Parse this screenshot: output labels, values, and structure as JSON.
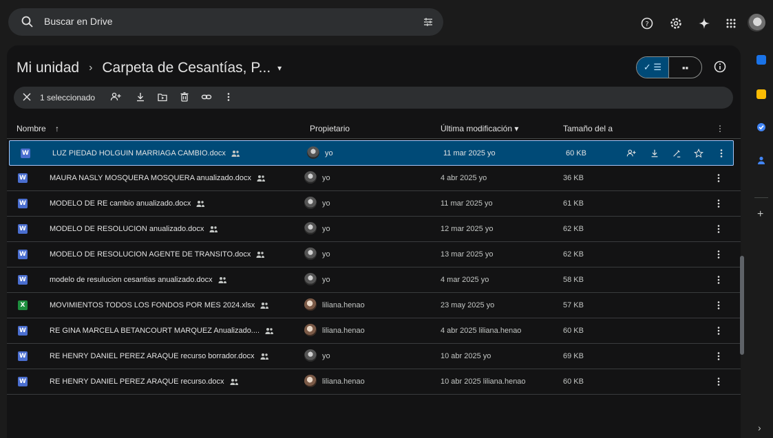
{
  "search": {
    "placeholder": "Buscar en Drive"
  },
  "top_icons": [
    "help-icon",
    "settings-icon",
    "gemini-sparkle-icon",
    "apps-grid-icon"
  ],
  "breadcrumb": {
    "root": "Mi unidad",
    "separator": "›",
    "current": "Carpeta de Cesantías, P...",
    "caret": "▾"
  },
  "view_toggle": {
    "list_label": "✓ ☰",
    "grid_label": "▪▪",
    "active": "list"
  },
  "selection_bar": {
    "count_label": "1 seleccionado"
  },
  "table": {
    "headers": {
      "name": "Nombre",
      "sort_arrow": "↑",
      "owner": "Propietario",
      "modified": "Última modificación ▾",
      "size": "Tamaño del a",
      "more": "⋮"
    },
    "rows": [
      {
        "name": "LUZ PIEDAD HOLGUIN MARRIAGA CAMBIO.docx",
        "type": "word",
        "owner": "yo",
        "owner_avatar": "me",
        "modified": "11 mar 2025 yo",
        "size": "60 KB",
        "selected": true
      },
      {
        "name": "MAURA NASLY MOSQUERA MOSQUERA anualizado.docx",
        "type": "word",
        "owner": "yo",
        "owner_avatar": "me",
        "modified": "4 abr 2025 yo",
        "size": "36 KB",
        "selected": false
      },
      {
        "name": "MODELO DE RE  cambio anualizado.docx",
        "type": "word",
        "owner": "yo",
        "owner_avatar": "me",
        "modified": "11 mar 2025 yo",
        "size": "61 KB",
        "selected": false
      },
      {
        "name": "MODELO DE RESOLUCION  anualizado.docx",
        "type": "word",
        "owner": "yo",
        "owner_avatar": "me",
        "modified": "12 mar 2025 yo",
        "size": "62 KB",
        "selected": false
      },
      {
        "name": "MODELO DE RESOLUCION AGENTE DE TRANSITO.docx",
        "type": "word",
        "owner": "yo",
        "owner_avatar": "me",
        "modified": "13 mar 2025 yo",
        "size": "62 KB",
        "selected": false
      },
      {
        "name": "modelo de resulucion  cesantias anualizado.docx",
        "type": "word",
        "owner": "yo",
        "owner_avatar": "me",
        "modified": "4 mar 2025 yo",
        "size": "58 KB",
        "selected": false
      },
      {
        "name": "MOVIMIENTOS TODOS LOS FONDOS POR MES 2024.xlsx",
        "type": "excel",
        "owner": "liliana.henao",
        "owner_avatar": "other",
        "modified": "23 may 2025 yo",
        "size": "57 KB",
        "selected": false
      },
      {
        "name": "RE GINA MARCELA BETANCOURT MARQUEZ Anualizado....",
        "type": "word",
        "owner": "liliana.henao",
        "owner_avatar": "other",
        "modified": "4 abr 2025 liliana.henao",
        "size": "60 KB",
        "selected": false
      },
      {
        "name": "RE HENRY DANIEL PEREZ ARAQUE recurso borrador.docx",
        "type": "word",
        "owner": "yo",
        "owner_avatar": "me",
        "modified": "10 abr 2025 yo",
        "size": "69 KB",
        "selected": false
      },
      {
        "name": "RE HENRY DANIEL PEREZ ARAQUE recurso.docx",
        "type": "word",
        "owner": "liliana.henao",
        "owner_avatar": "other",
        "modified": "10 abr 2025 liliana.henao",
        "size": "60 KB",
        "selected": false
      }
    ],
    "file_icon_letters": {
      "word": "W",
      "excel": "X"
    }
  },
  "right_rail": {
    "apps": [
      "calendar-icon",
      "keep-icon",
      "tasks-icon",
      "contacts-icon"
    ],
    "add": "+",
    "expand": "›"
  },
  "colors": {
    "background": "#1b1b1b",
    "panel": "#131314",
    "selected_row": "#004a77",
    "selected_border": "#a8c7fa",
    "word": "#4a6ecf",
    "excel": "#1e8e3e"
  }
}
